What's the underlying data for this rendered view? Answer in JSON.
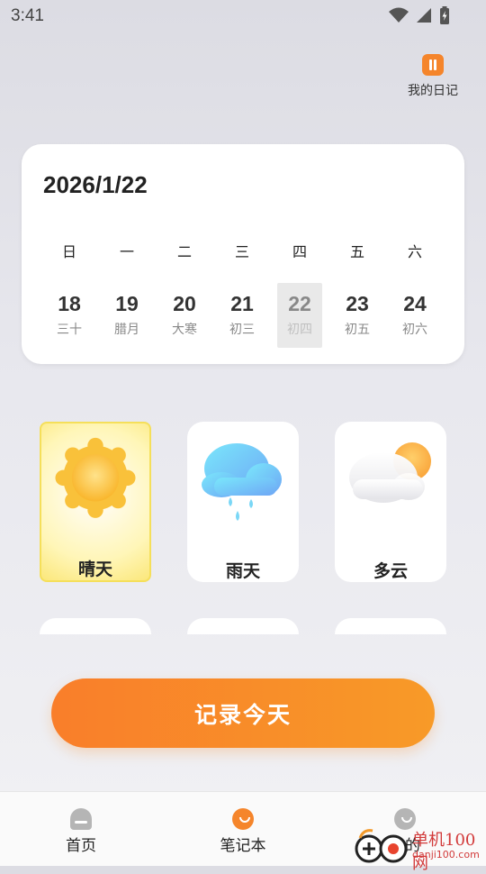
{
  "status_bar": {
    "time": "3:41"
  },
  "header": {
    "diary_label": "我的日记",
    "diary_icon": "pause-square-icon"
  },
  "calendar": {
    "date": "2026/1/22",
    "weekdays": [
      "日",
      "一",
      "二",
      "三",
      "四",
      "五",
      "六"
    ],
    "days": [
      {
        "num": "18",
        "lunar": "三十"
      },
      {
        "num": "19",
        "lunar": "腊月"
      },
      {
        "num": "20",
        "lunar": "大寒"
      },
      {
        "num": "21",
        "lunar": "初三"
      },
      {
        "num": "22",
        "lunar": "初四"
      },
      {
        "num": "23",
        "lunar": "初五"
      },
      {
        "num": "24",
        "lunar": "初六"
      }
    ],
    "selected_index": 4
  },
  "weather": [
    {
      "label": "晴天",
      "icon": "sun-icon",
      "selected": true
    },
    {
      "label": "雨天",
      "icon": "rain-cloud-icon",
      "selected": false
    },
    {
      "label": "多云",
      "icon": "partly-cloudy-icon",
      "selected": false
    }
  ],
  "record_button": {
    "label": "记录今天"
  },
  "bottom_nav": [
    {
      "label": "首页",
      "icon": "home-icon"
    },
    {
      "label": "笔记本",
      "icon": "notebook-icon",
      "active": true
    },
    {
      "label": "我的",
      "icon": "profile-icon"
    }
  ],
  "watermark": {
    "text": "单机100网",
    "domain": "danji100.com"
  },
  "colors": {
    "accent": "#f5852b",
    "button_start": "#f97e2a",
    "button_end": "#f89a28",
    "selected_day_bg": "#e9e9e9"
  }
}
